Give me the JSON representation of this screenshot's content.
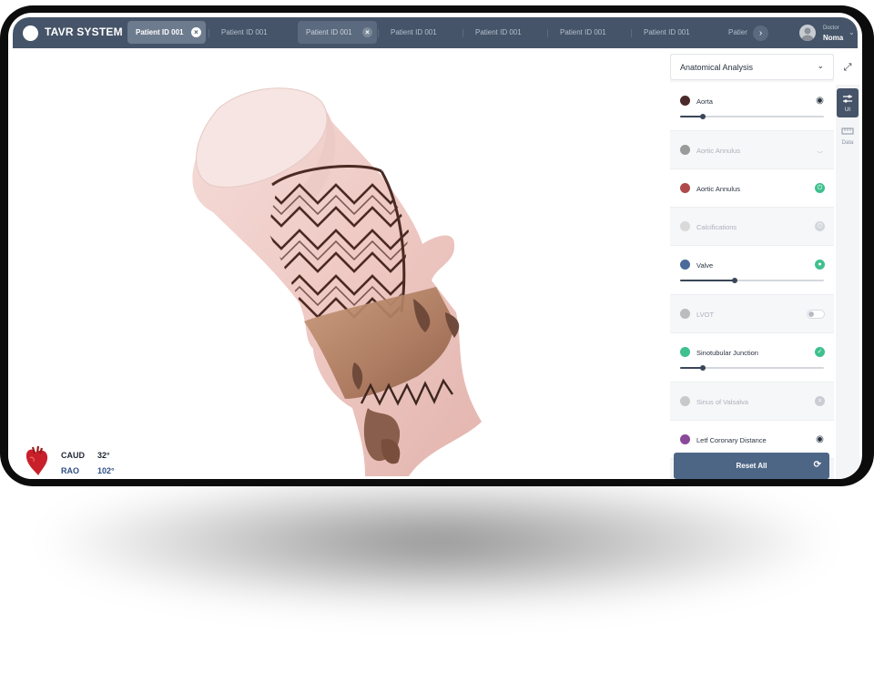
{
  "app": {
    "title": "TAVR SYSTEM"
  },
  "tabs": [
    {
      "label": "Patient ID 001",
      "state": "active",
      "closable": true
    },
    {
      "label": "Patient ID 001",
      "state": "inactive"
    },
    {
      "label": "Patient ID 001",
      "state": "open",
      "closable": true
    },
    {
      "label": "Patient ID 001",
      "state": "inactive"
    },
    {
      "label": "Patient ID 001",
      "state": "inactive"
    },
    {
      "label": "Patient ID 001",
      "state": "inactive"
    },
    {
      "label": "Patient ID 001",
      "state": "inactive"
    },
    {
      "label": "Patient",
      "state": "truncated"
    }
  ],
  "user": {
    "role": "Doctor",
    "name": "Noma"
  },
  "icons": {
    "tab_close": "×",
    "tab_next": "›",
    "caret": "⌄",
    "expand": "⤢",
    "reset": "⟳"
  },
  "view": {
    "angles": [
      {
        "label": "CAUD",
        "value": "32°",
        "color": "#1f2733"
      },
      {
        "label": "RAO",
        "value": "102°",
        "color": "#2f4f86"
      }
    ]
  },
  "panel": {
    "title": "Anatomical Analysis",
    "layers": [
      {
        "name": "Aorta",
        "color": "#4a2a2a",
        "dim": false,
        "control": "eye",
        "slider": 0.16
      },
      {
        "name": "Aortic Annulus",
        "color": "#9a9a9a",
        "dim": true,
        "control": "eye-closed"
      },
      {
        "name": "Aortic Annulus",
        "color": "#b04a4a",
        "dim": false,
        "control": "power-on"
      },
      {
        "name": "Calcifications",
        "color": "#d9d9d9",
        "dim": true,
        "control": "power-off"
      },
      {
        "name": "Valve",
        "color": "#4a6a9a",
        "dim": false,
        "control": "dot-on",
        "slider": 0.38
      },
      {
        "name": "LVOT",
        "color": "#bcbcbc",
        "dim": true,
        "control": "toggle-off"
      },
      {
        "name": "Sinotubular Junction",
        "color": "#3fc08e",
        "dim": false,
        "control": "check",
        "slider": 0.16
      },
      {
        "name": "Sinus of Valsalva",
        "color": "#c9c9c9",
        "dim": true,
        "control": "remove"
      },
      {
        "name": "Letf Coronary Distance",
        "color": "#8a4a9a",
        "dim": false,
        "control": "eye"
      }
    ],
    "reset_label": "Reset All"
  },
  "rail": [
    {
      "label": "UI",
      "icon": "sliders-icon",
      "active": true
    },
    {
      "label": "Data",
      "icon": "ruler-icon",
      "active": false
    }
  ],
  "colors": {
    "topbar": "#455468",
    "accent_green": "#3fc08e",
    "reset": "#4e6686"
  }
}
